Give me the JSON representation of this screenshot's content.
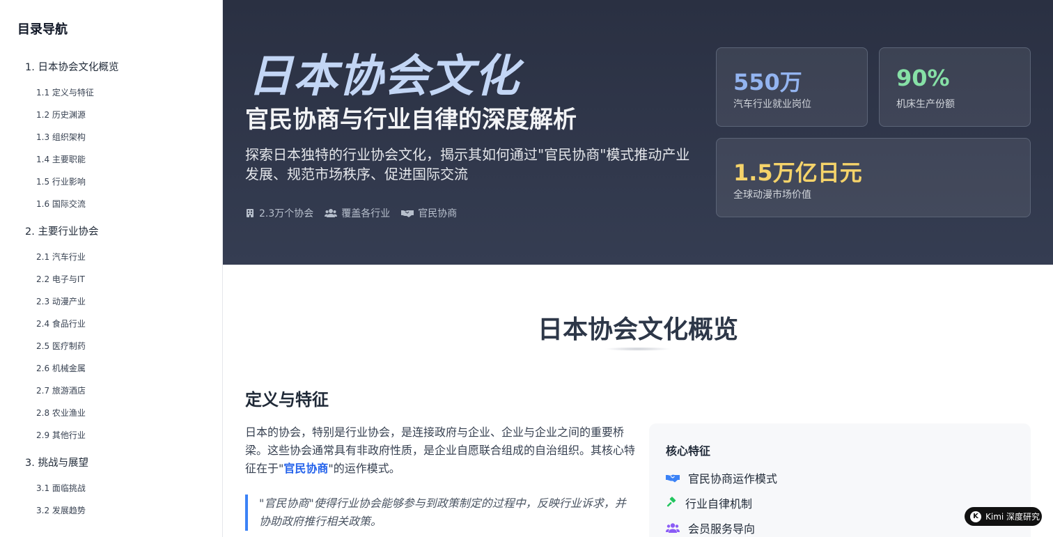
{
  "sidebar": {
    "title": "目录导航",
    "items": [
      {
        "level": 1,
        "label": "1. 日本协会文化概览"
      },
      {
        "level": 2,
        "label": "1.1 定义与特征"
      },
      {
        "level": 2,
        "label": "1.2 历史渊源"
      },
      {
        "level": 2,
        "label": "1.3 组织架构"
      },
      {
        "level": 2,
        "label": "1.4 主要职能"
      },
      {
        "level": 2,
        "label": "1.5 行业影响"
      },
      {
        "level": 2,
        "label": "1.6 国际交流"
      },
      {
        "level": 1,
        "label": "2. 主要行业协会"
      },
      {
        "level": 2,
        "label": "2.1 汽车行业"
      },
      {
        "level": 2,
        "label": "2.2 电子与IT"
      },
      {
        "level": 2,
        "label": "2.3 动漫产业"
      },
      {
        "level": 2,
        "label": "2.4 食品行业"
      },
      {
        "level": 2,
        "label": "2.5 医疗制药"
      },
      {
        "level": 2,
        "label": "2.6 机械金属"
      },
      {
        "level": 2,
        "label": "2.7 旅游酒店"
      },
      {
        "level": 2,
        "label": "2.8 农业渔业"
      },
      {
        "level": 2,
        "label": "2.9 其他行业"
      },
      {
        "level": 1,
        "label": "3. 挑战与展望"
      },
      {
        "level": 2,
        "label": "3.1 面临挑战"
      },
      {
        "level": 2,
        "label": "3.2 发展趋势"
      }
    ]
  },
  "hero": {
    "title": "日本协会文化",
    "subtitle": "官民协商与行业自律的深度解析",
    "description": "探索日本独特的行业协会文化，揭示其如何通过\"官民协商\"模式推动产业发展、规范市场秩序、促进国际交流",
    "tags": [
      {
        "icon": "building-icon",
        "label": "2.3万个协会"
      },
      {
        "icon": "users-icon",
        "label": "覆盖各行业"
      },
      {
        "icon": "handshake-icon",
        "label": "官民协商"
      }
    ],
    "stats": [
      {
        "value": "550万",
        "label": "汽车行业就业岗位",
        "color": "#93b4f0"
      },
      {
        "value": "90%",
        "label": "机床生产份额",
        "color": "#86e0a6"
      },
      {
        "value": "1.5万亿日元",
        "label": "全球动漫市场价值",
        "color": "#f5d36a"
      }
    ]
  },
  "main": {
    "section_title": "日本协会文化概览",
    "subsection_title": "定义与特征",
    "paragraph_before": "日本的协会，特别是行业协会，是连接政府与企业、企业与企业之间的重要桥梁。这些协会通常具有非政府性质，是企业自愿联合组成的自治组织。其核心特征在于\"",
    "paragraph_highlight": "官民协商",
    "paragraph_after": "\"的运作模式。",
    "quote": "\"官民协商\"使得行业协会能够参与到政策制定的过程中，反映行业诉求，并协助政府推行相关政策。",
    "features": {
      "title": "核心特征",
      "items": [
        {
          "icon": "handshake-icon",
          "label": "官民协商运作模式",
          "color": "#3b82f6"
        },
        {
          "icon": "gavel-icon",
          "label": "行业自律机制",
          "color": "#22c55e"
        },
        {
          "icon": "users-icon",
          "label": "会员服务导向",
          "color": "#8b5cf6"
        }
      ]
    }
  },
  "badge": {
    "logo": "K",
    "label": "Kimi 深度研究"
  }
}
